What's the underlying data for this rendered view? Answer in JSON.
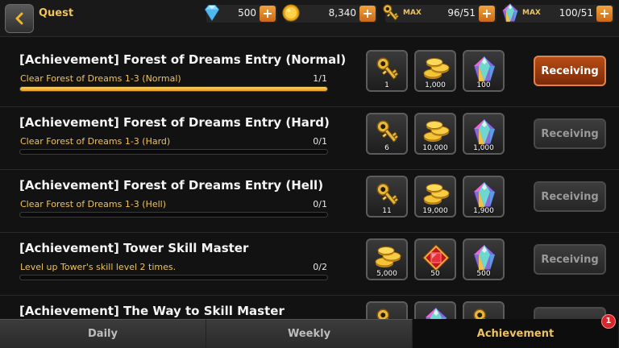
{
  "header": {
    "title": "Quest",
    "resources": [
      {
        "icon": "diamond-icon",
        "value": "500",
        "cap": ""
      },
      {
        "icon": "gold-coin-icon",
        "value": "8,340",
        "cap": ""
      },
      {
        "icon": "key-icon",
        "value": "96/51",
        "cap": "MAX"
      },
      {
        "icon": "crystal-icon",
        "value": "100/51",
        "cap": "MAX"
      }
    ]
  },
  "quests": [
    {
      "title": "[Achievement] Forest of Dreams Entry (Normal)",
      "desc": "Clear Forest of Dreams 1-3 (Normal)",
      "progress": "1/1",
      "fill": 1,
      "rewards": [
        {
          "icon": "key-icon",
          "qty": "1"
        },
        {
          "icon": "gold-coins-icon",
          "qty": "1,000"
        },
        {
          "icon": "crystal-icon",
          "qty": "100"
        }
      ],
      "button": "Receiving",
      "active": true
    },
    {
      "title": "[Achievement] Forest of Dreams Entry (Hard)",
      "desc": "Clear Forest of Dreams 1-3 (Hard)",
      "progress": "0/1",
      "fill": 0,
      "rewards": [
        {
          "icon": "key-icon",
          "qty": "6"
        },
        {
          "icon": "gold-coins-icon",
          "qty": "10,000"
        },
        {
          "icon": "crystal-icon",
          "qty": "1,000"
        }
      ],
      "button": "Receiving",
      "active": false
    },
    {
      "title": "[Achievement] Forest of Dreams Entry (Hell)",
      "desc": "Clear Forest of Dreams 1-3 (Hell)",
      "progress": "0/1",
      "fill": 0,
      "rewards": [
        {
          "icon": "key-icon",
          "qty": "11"
        },
        {
          "icon": "gold-coins-icon",
          "qty": "19,000"
        },
        {
          "icon": "crystal-icon",
          "qty": "1,900"
        }
      ],
      "button": "Receiving",
      "active": false
    },
    {
      "title": "[Achievement] Tower Skill Master",
      "desc": "Level up Tower's skill level 2 times.",
      "progress": "0/2",
      "fill": 0,
      "rewards": [
        {
          "icon": "gold-coins-icon",
          "qty": "5,000"
        },
        {
          "icon": "ruby-icon",
          "qty": "50"
        },
        {
          "icon": "crystal-icon",
          "qty": "500"
        }
      ],
      "button": "Receiving",
      "active": false
    },
    {
      "title": "[Achievement] The Way to Skill Master",
      "desc": "",
      "progress": "",
      "fill": 0,
      "rewards": [
        {
          "icon": "key-icon",
          "qty": ""
        },
        {
          "icon": "crystal-icon",
          "qty": ""
        },
        {
          "icon": "key-icon",
          "qty": ""
        }
      ],
      "button": "",
      "active": false
    }
  ],
  "tabs": [
    {
      "label": "Daily",
      "active": false
    },
    {
      "label": "Weekly",
      "active": false
    },
    {
      "label": "Achievement",
      "active": true
    }
  ],
  "badge": "1",
  "colors": {
    "accent": "#f0c35a",
    "active_button": "#b64d15",
    "progress_fill": "#e79a1c",
    "badge": "#d8262b"
  }
}
